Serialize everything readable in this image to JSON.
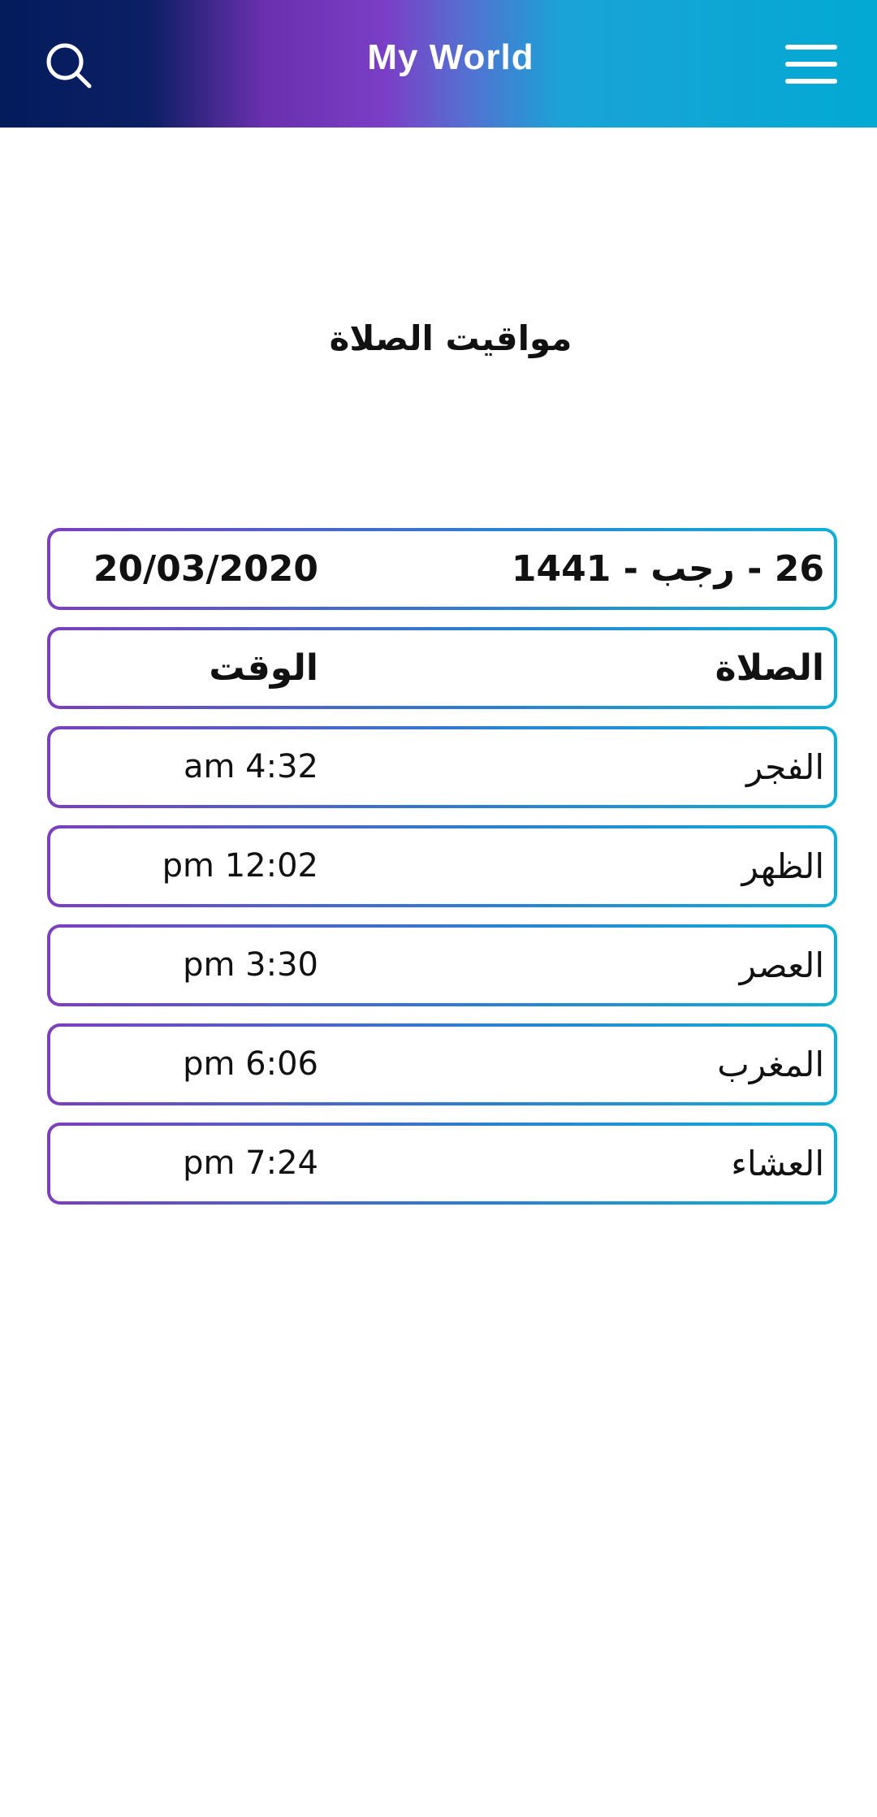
{
  "header": {
    "title": "My World",
    "search_icon": "search-icon",
    "menu_icon": "hamburger-menu-icon",
    "gradient_colors": [
      "#031c5c",
      "#7a3fc6",
      "#03a9d3"
    ]
  },
  "page": {
    "title": "مواقيت الصلاة"
  },
  "date_row": {
    "hijri": "26 - رجب - 1441",
    "gregorian": "20/03/2020"
  },
  "table": {
    "headers": {
      "prayer": "الصلاة",
      "time": "الوقت"
    },
    "rows": [
      {
        "prayer": "الفجر",
        "time": "am 4:32"
      },
      {
        "prayer": "الظهر",
        "time": "pm 12:02"
      },
      {
        "prayer": "العصر",
        "time": "pm 3:30"
      },
      {
        "prayer": "المغرب",
        "time": "pm 6:06"
      },
      {
        "prayer": "العشاء",
        "time": "pm 7:24"
      }
    ]
  },
  "colors": {
    "border_start": "#7b3fbe",
    "border_end": "#0fb0d6",
    "text": "#111111"
  }
}
